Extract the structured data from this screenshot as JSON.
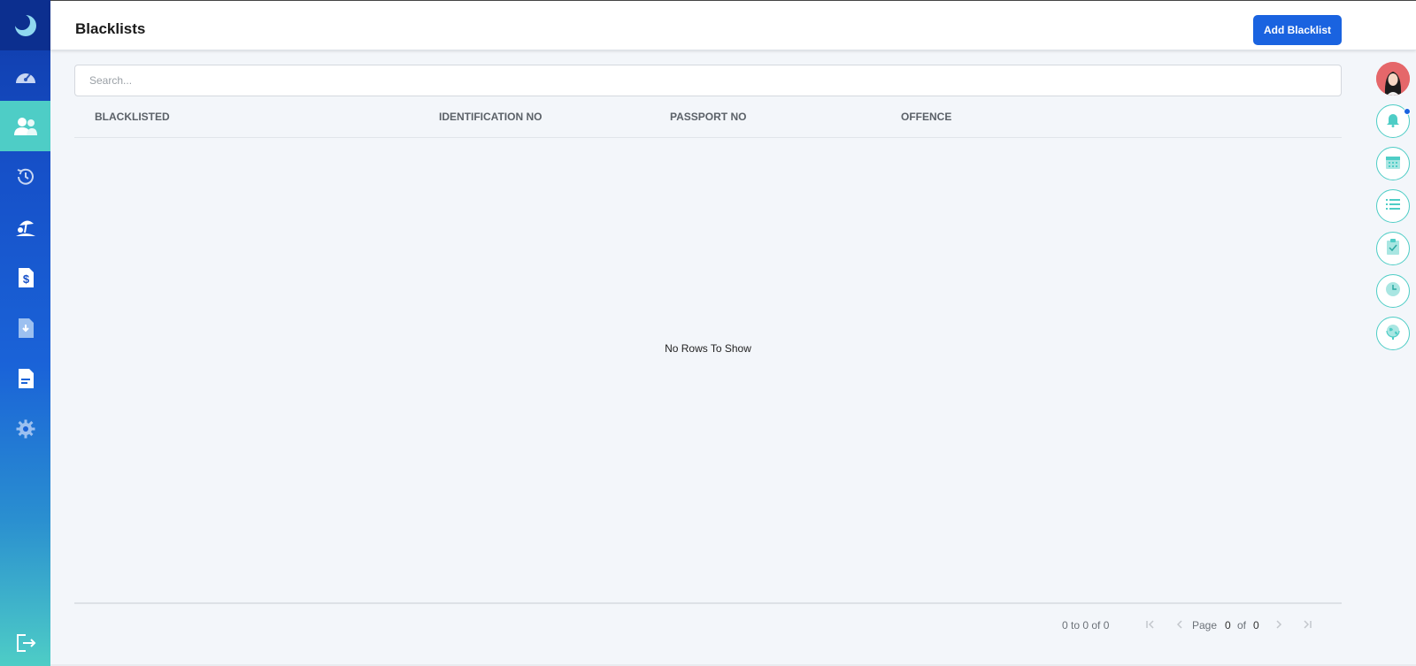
{
  "header": {
    "title": "Blacklists",
    "add_button_label": "Add Blacklist"
  },
  "search": {
    "placeholder": "Search...",
    "value": ""
  },
  "table": {
    "columns": [
      "BLACKLISTED",
      "IDENTIFICATION NO",
      "PASSPORT NO",
      "OFFENCE"
    ],
    "rows": [],
    "empty_message": "No Rows To Show"
  },
  "pagination": {
    "summary": "0 to 0 of 0",
    "page_label": "Page",
    "current_page": "0",
    "of_label": "of",
    "total_pages": "0",
    "first_icon": "first-page-icon",
    "prev_icon": "prev-page-icon",
    "next_icon": "next-page-icon",
    "last_icon": "last-page-icon"
  },
  "sidebar": {
    "logo": "moon-logo-icon",
    "items": [
      {
        "icon": "dashboard-gauge-icon",
        "active": false
      },
      {
        "icon": "users-icon",
        "active": true
      },
      {
        "icon": "history-icon",
        "active": false
      },
      {
        "icon": "leave-beach-icon",
        "active": false
      },
      {
        "icon": "payroll-dollar-icon",
        "active": false
      },
      {
        "icon": "download-document-icon",
        "active": false
      },
      {
        "icon": "report-document-icon",
        "active": false
      },
      {
        "icon": "settings-gear-icon",
        "active": false
      }
    ],
    "logout_icon": "logout-icon"
  },
  "right_rail": {
    "items": [
      "avatar",
      "bell-icon",
      "calendar-icon",
      "list-icon",
      "clipboard-check-icon",
      "clock-icon",
      "globe-icon"
    ]
  },
  "colors": {
    "accent": "#1a63e0",
    "teal": "#4ecdc6",
    "sidebar_dark": "#0c2f8f"
  }
}
